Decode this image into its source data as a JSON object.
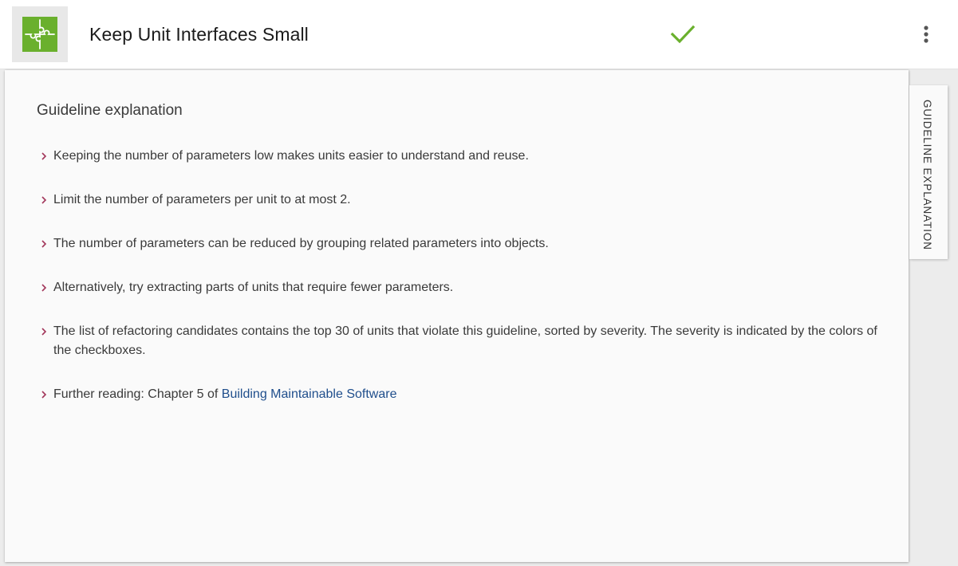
{
  "header": {
    "title": "Keep Unit Interfaces Small",
    "logo_icon": "puzzle-icon",
    "logo_color": "#6ab02d",
    "status_icon": "checkmark-icon",
    "status_color": "#6ab02d",
    "menu_icon": "more-vertical-icon"
  },
  "main": {
    "section_title": "Guideline explanation",
    "bullet_icon": "chevron-right-icon",
    "bullet_color": "#a2365a",
    "bullets": [
      {
        "text": "Keeping the number of parameters low makes units easier to understand and reuse."
      },
      {
        "text": "Limit the number of parameters per unit to at most 2."
      },
      {
        "text": "The number of parameters can be reduced by grouping related parameters into objects."
      },
      {
        "text": "Alternatively, try extracting parts of units that require fewer parameters."
      },
      {
        "text": "The list of refactoring candidates contains the top 30 of units that violate this guideline, sorted by severity. The severity is indicated by the colors of the checkboxes."
      },
      {
        "text": "Further reading: Chapter 5 of ",
        "link_text": "Building Maintainable Software",
        "link_color": "#1f4e8c"
      }
    ]
  },
  "side_tab": {
    "label": "GUIDELINE EXPLANATION"
  }
}
